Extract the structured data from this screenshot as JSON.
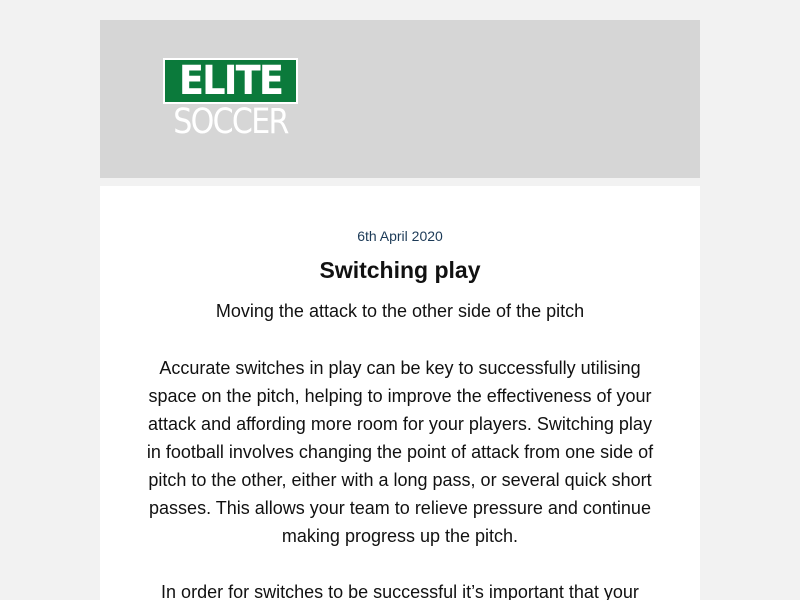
{
  "logo": {
    "text_top": "ELITE",
    "text_bottom": "SOCCER",
    "brand_green": "#0b7a3b"
  },
  "article": {
    "date": "6th April 2020",
    "title": "Switching play",
    "subtitle": "Moving the attack to the other side of the pitch",
    "paragraphs": [
      "Accurate switches in play can be key to successfully utilising space on the pitch, helping to improve the effectiveness of your attack and affording more room for your players. Switching play in football involves changing the point of attack from one side of pitch to the other, either with a long pass, or several quick short passes. This allows your team to relieve pressure and continue making progress up the pitch.",
      "In order for switches to be successful it’s important that your"
    ]
  },
  "colors": {
    "page_background": "#f2f2f2",
    "header_background": "#d6d6d6",
    "date_text": "#1c3a57"
  }
}
